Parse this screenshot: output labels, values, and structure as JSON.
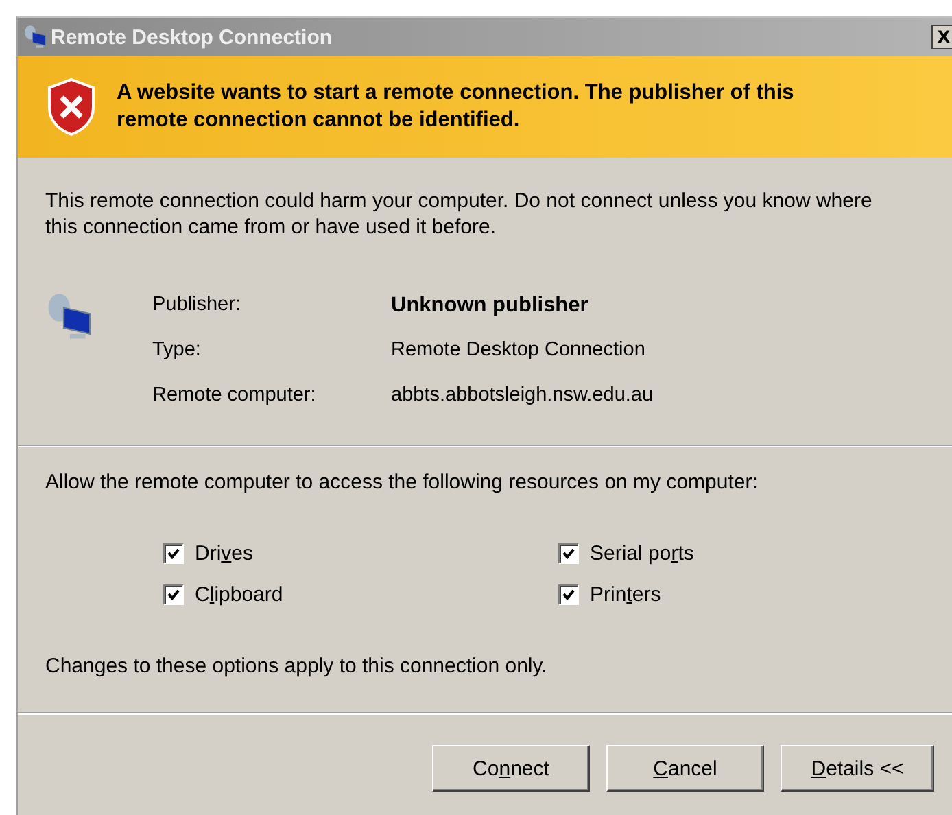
{
  "window": {
    "title": "Remote Desktop Connection",
    "close": "X"
  },
  "warning": {
    "text": "A website wants to start a remote connection. The publisher of this remote connection cannot be identified."
  },
  "description": "This remote connection could harm your computer. Do not connect unless you know where this connection came from or have used it before.",
  "details": [
    {
      "label": "Publisher:",
      "value": "Unknown publisher",
      "emphasis": true
    },
    {
      "label": "Type:",
      "value": "Remote Desktop Connection",
      "emphasis": false
    },
    {
      "label": "Remote computer:",
      "value": "abbts.abbotsleigh.nsw.edu.au",
      "emphasis": false
    }
  ],
  "resources_prompt": "Allow the remote computer to access the following resources on my computer:",
  "resources": [
    {
      "label": {
        "before": "Dri",
        "key": "v",
        "after": "es"
      },
      "checked": true
    },
    {
      "label": {
        "before": "Serial po",
        "key": "r",
        "after": "ts"
      },
      "checked": true
    },
    {
      "label": {
        "before": "C",
        "key": "l",
        "after": "ipboard"
      },
      "checked": true
    },
    {
      "label": {
        "before": "Prin",
        "key": "t",
        "after": "ers"
      },
      "checked": true
    }
  ],
  "note": "Changes to these options apply to this connection only.",
  "buttons": [
    {
      "label": {
        "before": "Co",
        "key": "n",
        "after": "nect"
      }
    },
    {
      "label": {
        "key": "C",
        "after": "ancel"
      }
    },
    {
      "label": {
        "key": "D",
        "after": "etails <<"
      }
    }
  ]
}
